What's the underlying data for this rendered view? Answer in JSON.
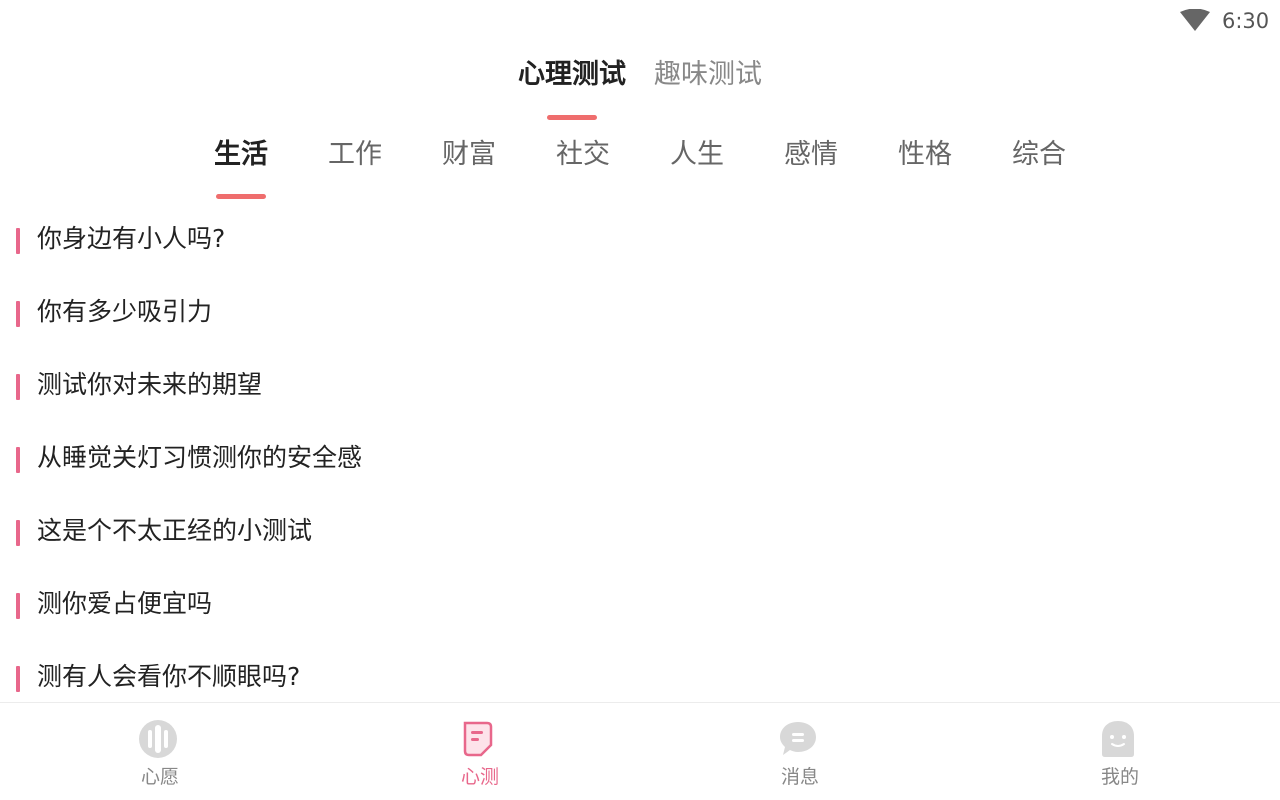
{
  "status": {
    "time": "6:30"
  },
  "main_tabs": [
    {
      "label": "心理测试",
      "active": true
    },
    {
      "label": "趣味测试",
      "active": false
    }
  ],
  "categories": [
    {
      "label": "生活",
      "active": true
    },
    {
      "label": "工作",
      "active": false
    },
    {
      "label": "财富",
      "active": false
    },
    {
      "label": "社交",
      "active": false
    },
    {
      "label": "人生",
      "active": false
    },
    {
      "label": "感情",
      "active": false
    },
    {
      "label": "性格",
      "active": false
    },
    {
      "label": "综合",
      "active": false
    }
  ],
  "tests": [
    "你身边有小人吗?",
    "你有多少吸引力",
    "测试你对未来的期望",
    "从睡觉关灯习惯测你的安全感",
    "这是个不太正经的小测试",
    "测你爱占便宜吗",
    "测有人会看你不顺眼吗?"
  ],
  "bottom_nav": [
    {
      "label": "心愿",
      "icon": "wish-icon",
      "active": false
    },
    {
      "label": "心测",
      "icon": "test-icon",
      "active": true
    },
    {
      "label": "消息",
      "icon": "message-icon",
      "active": false
    },
    {
      "label": "我的",
      "icon": "profile-icon",
      "active": false
    }
  ],
  "colors": {
    "accent": "#e8678b",
    "indicator": "#ef6d6d",
    "text_primary": "#222222",
    "text_secondary": "#888888"
  }
}
